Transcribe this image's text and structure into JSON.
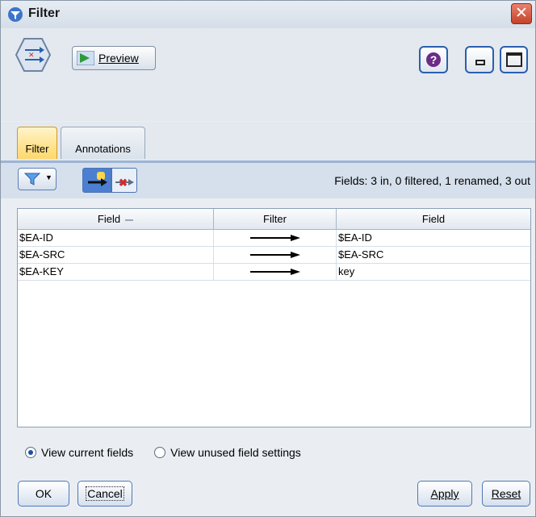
{
  "window": {
    "title": "Filter"
  },
  "toolbar": {
    "preview_label": "Preview"
  },
  "tabs": [
    {
      "label": "Filter",
      "active": true
    },
    {
      "label": "Annotations",
      "active": false
    }
  ],
  "fields_summary": "Fields: 3 in, 0 filtered, 1 renamed, 3 out",
  "table": {
    "headers": [
      "Field",
      "Filter",
      "Field"
    ],
    "rows": [
      {
        "field_in": "$EA-ID",
        "filter": "pass",
        "field_out": "$EA-ID"
      },
      {
        "field_in": "$EA-SRC",
        "filter": "pass",
        "field_out": "$EA-SRC"
      },
      {
        "field_in": "$EA-KEY",
        "filter": "pass",
        "field_out": "key"
      }
    ]
  },
  "view_options": [
    {
      "label": "View current fields",
      "selected": true
    },
    {
      "label": "View unused field settings",
      "selected": false
    }
  ],
  "buttons": {
    "ok": "OK",
    "cancel": "Cancel",
    "apply": "Apply",
    "reset": "Reset"
  },
  "colors": {
    "active_tab": "#ffd86b",
    "selection_blue": "#4b7fd1",
    "close_red": "#c4412a"
  }
}
